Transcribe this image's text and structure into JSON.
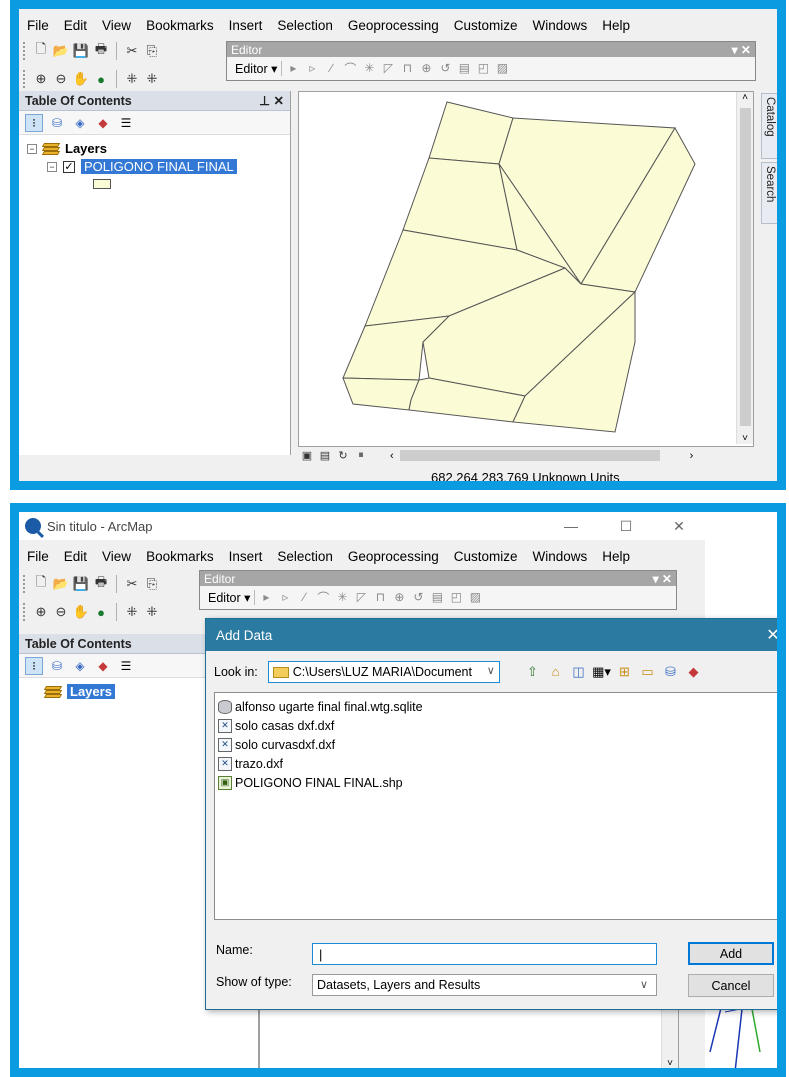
{
  "top": {
    "menu": [
      "File",
      "Edit",
      "View",
      "Bookmarks",
      "Insert",
      "Selection",
      "Geoprocessing",
      "Customize",
      "Windows",
      "Help"
    ],
    "editor_toolbar": {
      "title": "Editor",
      "button": "Editor ▾"
    },
    "toc": {
      "title": "Table Of Contents",
      "pin": "⊥ ✕",
      "layers_label": "Layers",
      "layer_name": "POLIGONO FINAL FINAL"
    },
    "side_tabs": [
      "Catalog",
      "Search"
    ],
    "status": {
      "coords": "682.264  283.769 Unknown Units"
    },
    "map": {
      "fill_color": "#fbfbd6",
      "stroke_color": "#555555"
    }
  },
  "bottom": {
    "window_title": "Sin titulo - ArcMap",
    "menu": [
      "File",
      "Edit",
      "View",
      "Bookmarks",
      "Insert",
      "Selection",
      "Geoprocessing",
      "Customize",
      "Windows",
      "Help"
    ],
    "editor_toolbar": {
      "title": "Editor",
      "button": "Editor ▾"
    },
    "toc": {
      "title": "Table Of Contents",
      "layers_label": "Layers"
    },
    "dialog": {
      "title": "Add Data",
      "look_in_label": "Look in:",
      "look_in_value": "C:\\Users\\LUZ MARIA\\Document",
      "files": [
        {
          "name": "alfonso ugarte final final.wtg.sqlite",
          "icon": "database-icon"
        },
        {
          "name": "solo casas dxf.dxf",
          "icon": "cad-icon"
        },
        {
          "name": "solo curvasdxf.dxf",
          "icon": "cad-icon"
        },
        {
          "name": "trazo.dxf",
          "icon": "cad-icon"
        },
        {
          "name": "POLIGONO FINAL FINAL.shp",
          "icon": "shapefile-icon"
        }
      ],
      "name_label": "Name:",
      "name_value": "|",
      "type_label": "Show of type:",
      "type_value": "Datasets, Layers and Results",
      "add_button": "Add",
      "cancel_button": "Cancel"
    },
    "accent_color": "#2b7aa1"
  }
}
